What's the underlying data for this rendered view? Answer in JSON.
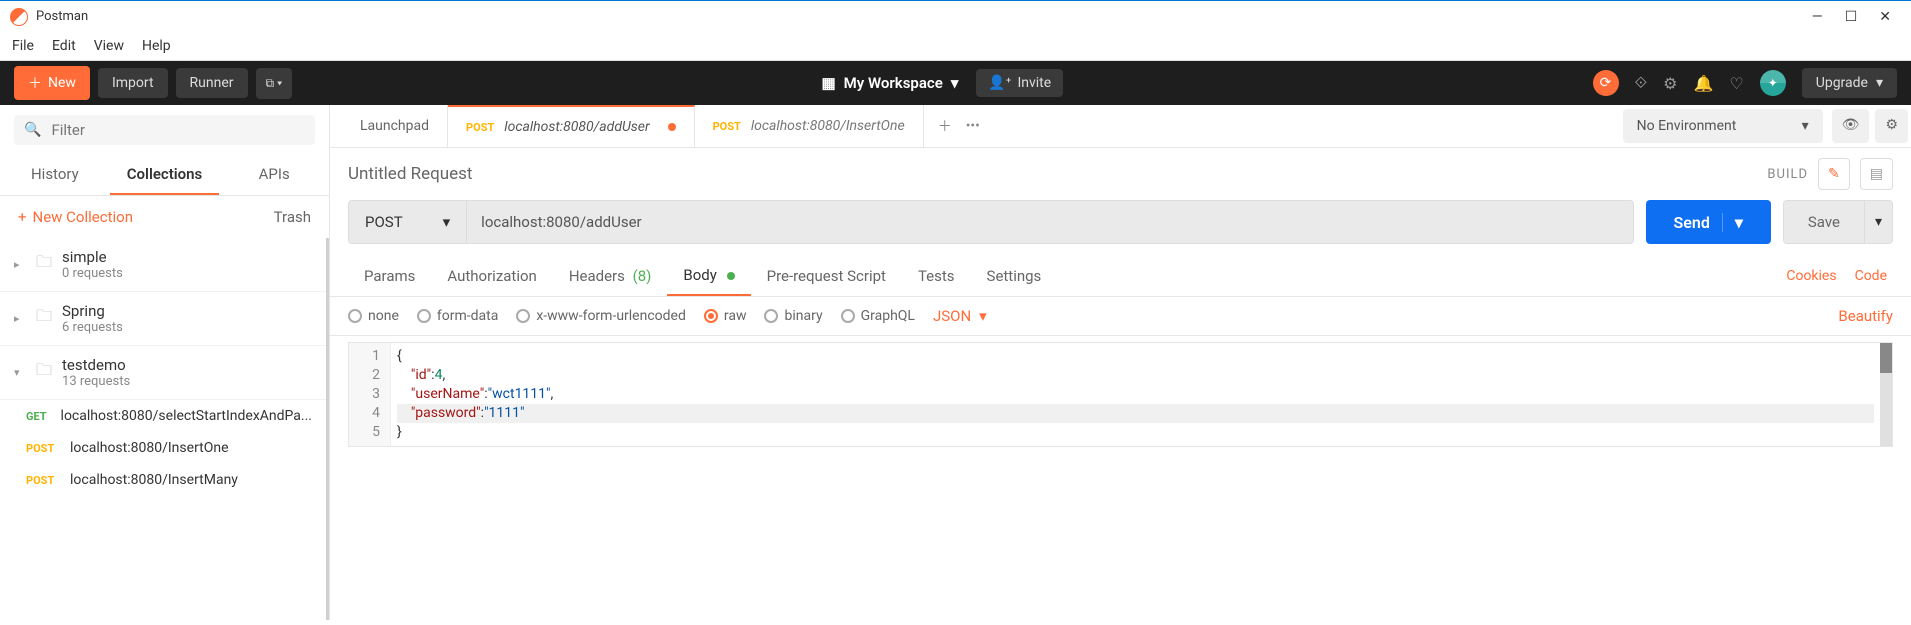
{
  "window": {
    "title": "Postman"
  },
  "menu": {
    "file": "File",
    "edit": "Edit",
    "view": "View",
    "help": "Help"
  },
  "toolbar": {
    "new": "New",
    "import": "Import",
    "runner": "Runner",
    "workspace": "My Workspace",
    "invite": "Invite",
    "upgrade": "Upgrade"
  },
  "sidebar": {
    "filter_placeholder": "Filter",
    "tabs": {
      "history": "History",
      "collections": "Collections",
      "apis": "APIs"
    },
    "new_collection": "New Collection",
    "trash": "Trash",
    "collections": [
      {
        "name": "simple",
        "count": "0 requests"
      },
      {
        "name": "Spring",
        "count": "6 requests"
      },
      {
        "name": "testdemo",
        "count": "13 requests"
      }
    ],
    "requests": [
      {
        "method": "GET",
        "url": "localhost:8080/selectStartIndexAndPa..."
      },
      {
        "method": "POST",
        "url": "localhost:8080/InsertOne"
      },
      {
        "method": "POST",
        "url": "localhost:8080/InsertMany"
      }
    ]
  },
  "tabs": {
    "launchpad": "Launchpad",
    "tab1_method": "POST",
    "tab1_url": "localhost:8080/addUser",
    "tab2_method": "POST",
    "tab2_url": "localhost:8080/InsertOne",
    "no_env": "No Environment"
  },
  "request": {
    "name": "Untitled Request",
    "build": "BUILD",
    "method": "POST",
    "url": "localhost:8080/addUser",
    "send": "Send",
    "save": "Save"
  },
  "req_tabs": {
    "params": "Params",
    "auth": "Authorization",
    "headers": "Headers",
    "headers_count": "(8)",
    "body": "Body",
    "prerequest": "Pre-request Script",
    "tests": "Tests",
    "settings": "Settings",
    "cookies": "Cookies",
    "code": "Code"
  },
  "body_types": {
    "none": "none",
    "formdata": "form-data",
    "xwww": "x-www-form-urlencoded",
    "raw": "raw",
    "binary": "binary",
    "graphql": "GraphQL",
    "json": "JSON",
    "beautify": "Beautify"
  },
  "editor": {
    "raw_body": {
      "id": 4,
      "userName": "wct1111",
      "password": "1111"
    },
    "lines": {
      "1": "1",
      "2": "2",
      "3": "3",
      "4": "4",
      "5": "5"
    },
    "tokens": {
      "open_brace": "{",
      "close_brace": "}",
      "id_key": "\"id\"",
      "id_val": "4",
      "comma": ",",
      "colon": ":",
      "user_key": "\"userName\"",
      "user_val": "\"wct1111\"",
      "pass_key": "\"password\"",
      "pass_val": "\"1111\""
    }
  }
}
